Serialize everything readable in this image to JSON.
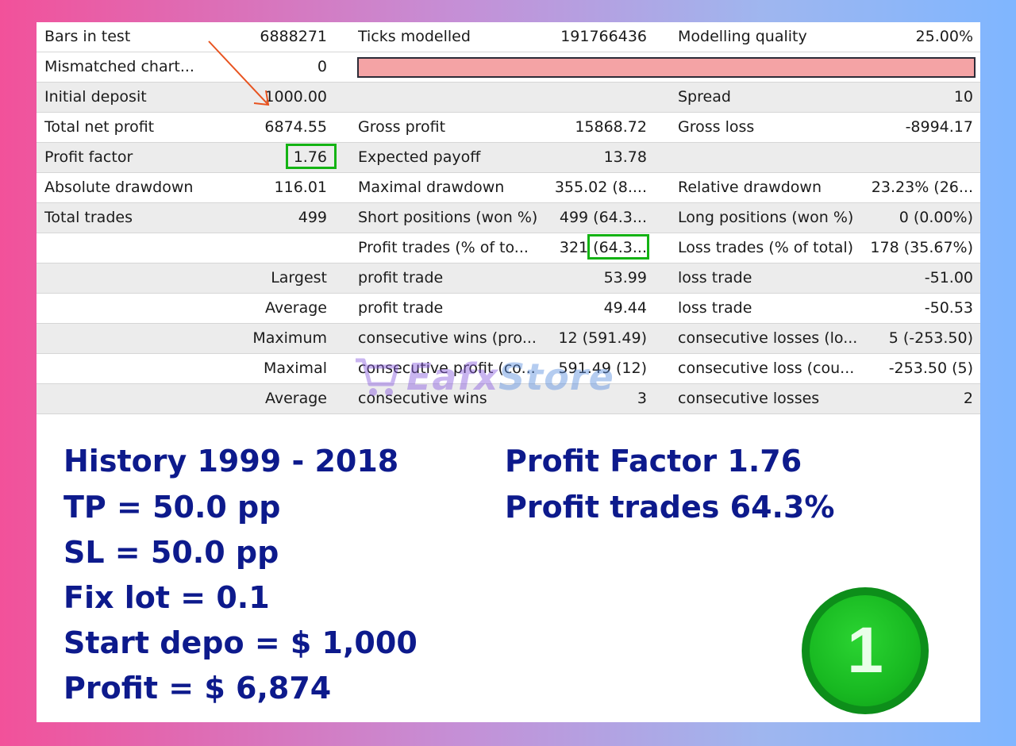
{
  "report": {
    "rows": [
      {
        "c1": "Bars in test",
        "c2": "6888271",
        "c3": "Ticks modelled",
        "c4": "191766436",
        "c5": "Modelling quality",
        "c6": "25.00%"
      },
      {
        "c1": "Mismatched chart...",
        "c2": "0",
        "c3": "",
        "c4": "",
        "c5": "",
        "c6": ""
      },
      {
        "c1": "Initial deposit",
        "c2": "1000.00",
        "c3": "",
        "c4": "",
        "c5": "Spread",
        "c6": "10"
      },
      {
        "c1": "Total net profit",
        "c2": "6874.55",
        "c3": "Gross profit",
        "c4": "15868.72",
        "c5": "Gross loss",
        "c6": "-8994.17"
      },
      {
        "c1": "Profit factor",
        "c2": "1.76",
        "c3": "Expected payoff",
        "c4": "13.78",
        "c5": "",
        "c6": ""
      },
      {
        "c1": "Absolute drawdown",
        "c2": "116.01",
        "c3": "Maximal drawdown",
        "c4": "355.02 (8....",
        "c5": "Relative drawdown",
        "c6": "23.23% (26..."
      },
      {
        "c1": "Total trades",
        "c2": "499",
        "c3": "Short positions (won %)",
        "c4": "499 (64.3...",
        "c5": "Long positions (won %)",
        "c6": "0 (0.00%)"
      },
      {
        "c1": "",
        "c2": "",
        "c3": "Profit trades (% of to...",
        "c4": "321 (64.3...",
        "c5": "Loss trades (% of total)",
        "c6": "178 (35.67%)"
      },
      {
        "c12": "Largest",
        "c3": "profit trade",
        "c4": "53.99",
        "c5": "loss trade",
        "c6": "-51.00"
      },
      {
        "c12": "Average",
        "c3": "profit trade",
        "c4": "49.44",
        "c5": "loss trade",
        "c6": "-50.53"
      },
      {
        "c12": "Maximum",
        "c3": "consecutive wins (pro...",
        "c4": "12 (591.49)",
        "c5": "consecutive losses (lo...",
        "c6": "5 (-253.50)"
      },
      {
        "c12": "Maximal",
        "c3": "consecutive profit (co...",
        "c4": "591.49 (12)",
        "c5": "consecutive loss (cou...",
        "c6": "-253.50 (5)"
      },
      {
        "c12": "Average",
        "c3": "consecutive wins",
        "c4": "3",
        "c5": "consecutive losses",
        "c6": "2"
      }
    ]
  },
  "watermark": {
    "part1": "Eafx",
    "part2": "Store"
  },
  "notes": {
    "left": [
      "History 1999 - 2018",
      "TP = 50.0 pp",
      "SL = 50.0 pp",
      "Fix lot = 0.1",
      "Start depo = $ 1,000",
      "Profit = $ 6,874"
    ],
    "right": [
      "Profit Factor 1.76",
      "Profit trades 64.3%"
    ]
  },
  "badge": {
    "number": "1"
  },
  "colors": {
    "note_text": "#0d1a8c",
    "highlight": "#14b314",
    "arrow": "#e8531f",
    "mismatch_bar": "#f4a3a5"
  }
}
